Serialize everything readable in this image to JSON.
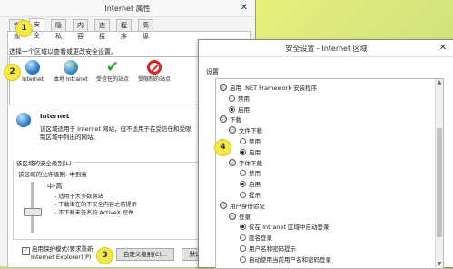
{
  "properties_window": {
    "title": "Internet 属性",
    "close": "✕",
    "tabs": [
      "常规",
      "安全",
      "隐私",
      "内容",
      "连接",
      "程序",
      "高级"
    ],
    "zone_prompt": "选择一个区域以查看或更改安全设置。",
    "zones": [
      {
        "label": "Internet",
        "icon": "globe-icon"
      },
      {
        "label": "本地 Intranet",
        "icon": "intranet-globe-icon"
      },
      {
        "label": "受信任的站点",
        "icon": "check-icon"
      },
      {
        "label": "受限制的站点",
        "icon": "no-entry-icon"
      }
    ],
    "selected_zone_name": "Internet",
    "zone_description": "该区域适用于 Internet 网站，但不适用于在受信任和受限制区域中列出的网站。",
    "security_level_group": "该区域的安全级别(L)",
    "allowed_levels": "该区域的允许级别: 中到高",
    "level_name": "中-高",
    "level_points": [
      "- 适用于大多数网站",
      "- 下载潜在的不安全内容之前提示",
      "- 不下载未签名的 ActiveX 控件"
    ],
    "protected_mode_line1": "启用保护模式(要求重新",
    "protected_mode_line2": "Internet Explorer)(P)",
    "custom_level_button": "自定义级别(C)...",
    "default_level_button": "默认"
  },
  "callouts": [
    "1",
    "2",
    "3",
    "4"
  ],
  "security_dialog": {
    "title": "安全设置 - Internet 区域",
    "close": "✕",
    "settings_label": "设置",
    "tree": [
      {
        "text": "启用 .NET Framework 安装程序",
        "kind": "setting",
        "level": 0
      },
      {
        "text": "禁用",
        "kind": "radio",
        "level": 1,
        "checked": false
      },
      {
        "text": "启用",
        "kind": "radio",
        "level": 1,
        "checked": true
      },
      {
        "text": "下载",
        "kind": "category",
        "level": 0
      },
      {
        "text": "文件下载",
        "kind": "setting",
        "level": 1
      },
      {
        "text": "禁用",
        "kind": "radio",
        "level": 2,
        "checked": false
      },
      {
        "text": "启用",
        "kind": "radio",
        "level": 2,
        "checked": true
      },
      {
        "text": "字体下载",
        "kind": "setting",
        "level": 1
      },
      {
        "text": "禁用",
        "kind": "radio",
        "level": 2,
        "checked": false
      },
      {
        "text": "启用",
        "kind": "radio",
        "level": 2,
        "checked": true
      },
      {
        "text": "提示",
        "kind": "radio",
        "level": 2,
        "checked": false
      },
      {
        "text": "用户身份验证",
        "kind": "category",
        "level": 0
      },
      {
        "text": "登录",
        "kind": "setting",
        "level": 1
      },
      {
        "text": "仅在 Intranet 区域中自动登录",
        "kind": "radio",
        "level": 2,
        "checked": true
      },
      {
        "text": "匿名登录",
        "kind": "radio",
        "level": 2,
        "checked": false
      },
      {
        "text": "用户名和密码提示",
        "kind": "radio",
        "level": 2,
        "checked": false
      },
      {
        "text": "自动使用当前用户名和密码登录",
        "kind": "radio",
        "level": 2,
        "checked": false
      }
    ]
  }
}
